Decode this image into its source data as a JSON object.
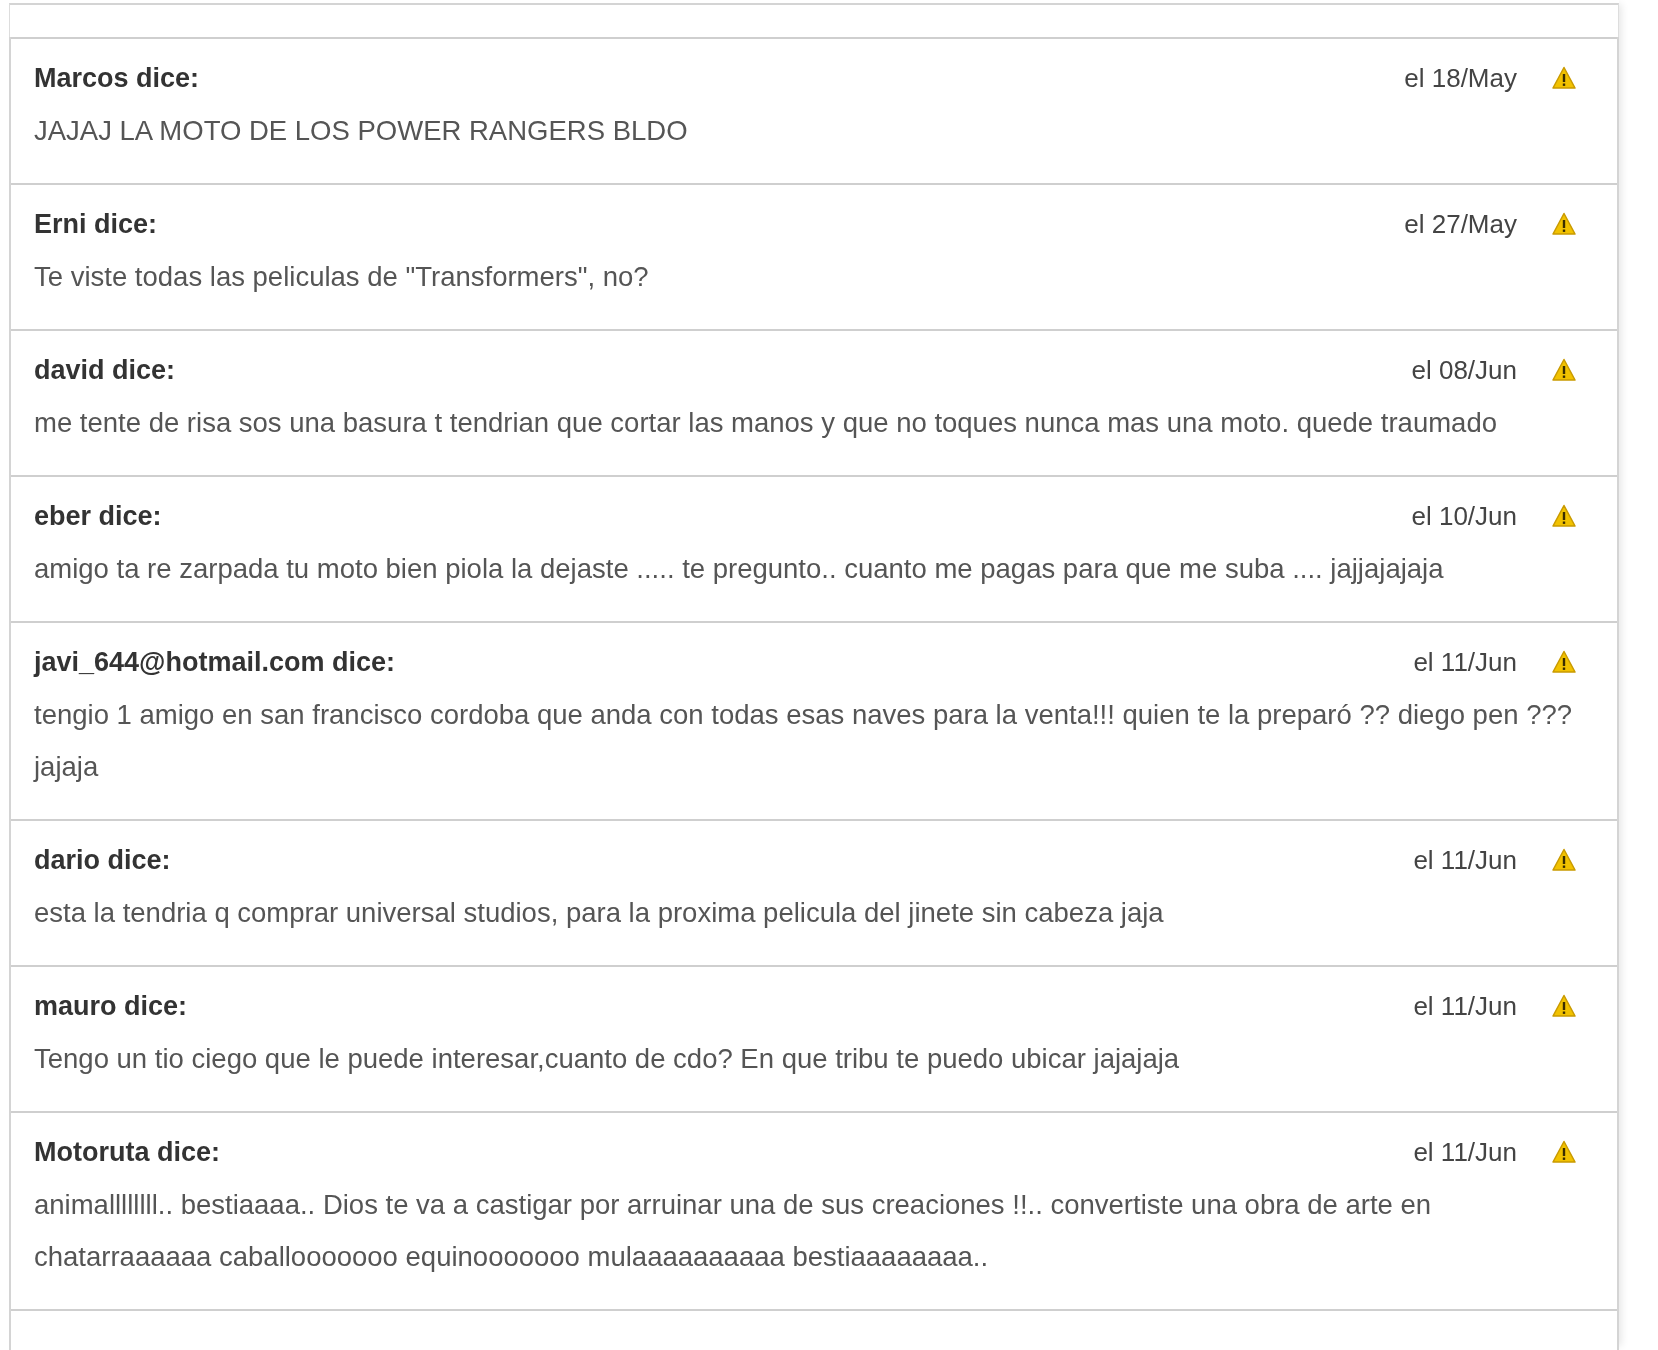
{
  "comments": [
    {
      "author": "Marcos dice:",
      "date": "el 18/May",
      "text": "JAJAJ LA MOTO DE LOS POWER RANGERS BLDO"
    },
    {
      "author": "Erni dice:",
      "date": "el 27/May",
      "text": "Te viste todas las peliculas de \"Transformers\", no?"
    },
    {
      "author": "david dice:",
      "date": "el 08/Jun",
      "text": "me tente de risa sos una basura t tendrian que cortar las manos y que no toques nunca mas una moto. quede traumado"
    },
    {
      "author": "eber dice:",
      "date": "el 10/Jun",
      "text": "amigo ta re zarpada tu moto bien piola la dejaste ..... te pregunto.. cuanto me pagas para que me suba .... jajjajajaja"
    },
    {
      "author": "javi_644@hotmail.com dice:",
      "date": "el 11/Jun",
      "text": "tengio 1 amigo en san francisco cordoba que anda con todas esas naves para la venta!!! quien te la preparó ?? diego pen ???jajaja"
    },
    {
      "author": "dario dice:",
      "date": "el 11/Jun",
      "text": "esta la tendria q comprar universal studios, para la proxima pelicula del jinete sin cabeza jaja"
    },
    {
      "author": "mauro dice:",
      "date": "el 11/Jun",
      "text": "Tengo un tio ciego que le puede interesar,cuanto de cdo? En que tribu te puedo ubicar jajajaja"
    },
    {
      "author": "Motoruta dice:",
      "date": "el 11/Jun",
      "text": "animallllllll.. bestiaaaa.. Dios te va a castigar por arruinar una de sus creaciones !!.. convertiste una obra de arte en chatarraaaaaa caballooooooo equinooooooo mulaaaaaaaaaa bestiaaaaaaaa.."
    }
  ]
}
